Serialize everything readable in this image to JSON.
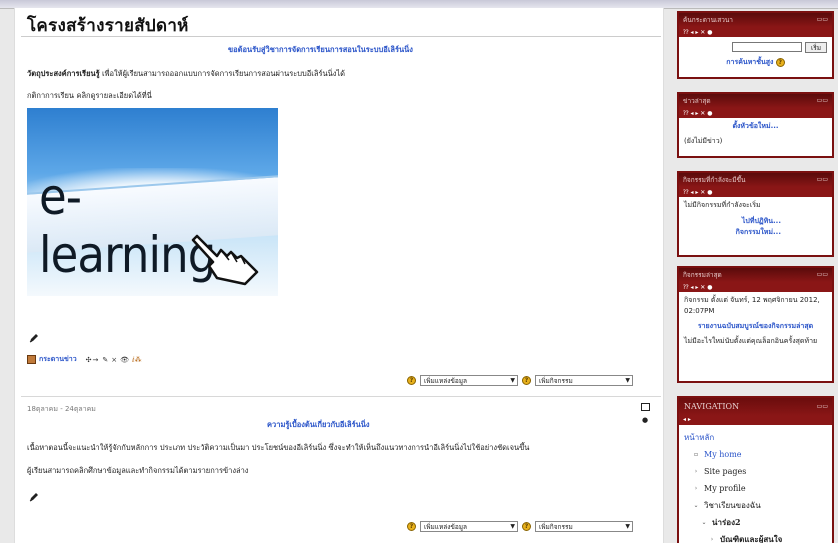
{
  "course": {
    "title": "โครงสร้างรายสัปดาห์"
  },
  "topic0": {
    "greeting_link": "ขอต้อนรับสู่วิชาการจัดการเรียนการสอนในระบบอีเลิร์นนิ่ง",
    "objective_label": "วัตถุประสงค์การเรียนรู้",
    "objective_text": " เพื่อให้ผู้เรียนสามารถออกแบบการจัดการเรียนการสอนผ่านระบบอีเลิร์นนิ่งได้",
    "rules_text": "กติกาการเรียน คลิกดูรายละเอียดได้ที่นี่",
    "image_word": "e-learning...",
    "forum_link": "กระดานข่าว",
    "add_resource": "เพิ่มแหล่งข้อมูล",
    "add_activity": "เพิ่มกิจกรรม"
  },
  "week1": {
    "date": "18ตุลาคม - 24ตุลาคม",
    "heading_link": "ความรู้เบื้องต้นเกี่ยวกับอีเลิร์นนิ่ง",
    "text1": "เนื้อหาตอนนี้จะแนะนำให้รู้จักกับหลักการ ประเภท ประวัติความเป็นมา ประโยชน์ของอีเลิร์นนิ่ง ซึ่งจะทำให้เห็นถึงแนวทางการนำอีเลิร์นนิ่งไปใช้อย่างชัดเจนขึ้น",
    "text2": "ผู้เรียนสามารถคลิกศึกษาข้อมูลและทำกิจกรรมได้ตามรายการข้างล่าง",
    "add_resource": "เพิ่มแหล่งข้อมูล",
    "add_activity": "เพิ่มกิจกรรม"
  },
  "blocks": {
    "search": {
      "title": "ค้นกระดานเสวนา",
      "button": "เริ่ม",
      "advanced_link": "การค้นหาชั้นสูง"
    },
    "news": {
      "title": "ข่าวล่าสุด",
      "add_topic_link": "ตั้งหัวข้อใหม่...",
      "empty_text": "(ยังไม่มีข่าว)"
    },
    "upcoming": {
      "title": "กิจกรรมที่กำลังจะมีขึ้น",
      "empty_text": "ไม่มีกิจกรรมที่กำลังจะเริ่ม",
      "calendar_link": "ไปที่ปฏิทิน...",
      "new_event_link": "กิจกรรมใหม่..."
    },
    "recent": {
      "title": "กิจกรรมล่าสุด",
      "since_text": "กิจกรรม ตั้งแต่ จันทร์, 12 พฤศจิกายน 2012, 02:07PM",
      "full_report_link": "รายงานฉบับสมบูรณ์ของกิจกรรมล่าสุด",
      "nothing_text": "ไม่มีอะไรใหม่นับตั้งแต่คุณล็อกอินครั้งสุดท้าย"
    },
    "navigation": {
      "title": "NAVIGATION",
      "home": "หน้าหลัก",
      "items": [
        "My home",
        "Site pages",
        "My profile",
        "วิชาเรียนของฉัน",
        "น่าร่อง2",
        "บัณฑิตและผู้สนใจ"
      ]
    }
  }
}
